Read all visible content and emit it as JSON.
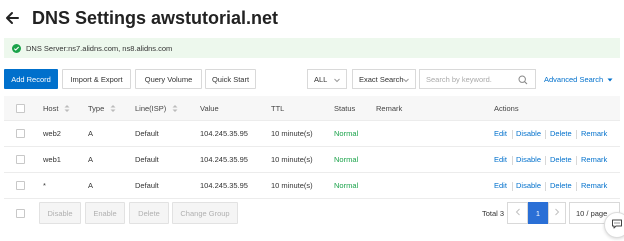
{
  "header": {
    "title": "DNS Settings awstutorial.net"
  },
  "info": {
    "text": "DNS Server:ns7.alidns.com, ns8.alidns.com"
  },
  "toolbar": {
    "add_record": "Add Record",
    "import_export": "Import & Export",
    "query_volume": "Query Volume",
    "quick_start": "Quick Start",
    "filter_select": "ALL",
    "search_type": "Exact Search",
    "search_placeholder": "Search by keyword.",
    "advanced_search": "Advanced Search"
  },
  "table": {
    "columns": {
      "host": "Host",
      "type": "Type",
      "line": "Line(ISP)",
      "value": "Value",
      "ttl": "TTL",
      "status": "Status",
      "remark": "Remark",
      "actions": "Actions"
    },
    "rows": [
      {
        "host": "web2",
        "type": "A",
        "line": "Default",
        "value": "104.245.35.95",
        "ttl": "10 minute(s)",
        "status": "Normal",
        "remark": ""
      },
      {
        "host": "web1",
        "type": "A",
        "line": "Default",
        "value": "104.245.35.95",
        "ttl": "10 minute(s)",
        "status": "Normal",
        "remark": ""
      },
      {
        "host": "*",
        "type": "A",
        "line": "Default",
        "value": "104.245.35.95",
        "ttl": "10 minute(s)",
        "status": "Normal",
        "remark": ""
      }
    ],
    "actions": {
      "edit": "Edit",
      "disable": "Disable",
      "delete": "Delete",
      "remark": "Remark"
    }
  },
  "footer": {
    "disable": "Disable",
    "enable": "Enable",
    "delete": "Delete",
    "change_group": "Change Group",
    "total": "Total 3",
    "current_page": "1",
    "page_size": "10 / page"
  },
  "colors": {
    "accent": "#0070cc",
    "success": "#1aa34a",
    "info_bg": "#edf8ed"
  },
  "icons": [
    "back-arrow-icon",
    "check-circle-icon",
    "chevron-down-icon",
    "search-icon",
    "sort-icon",
    "chevron-left-icon",
    "chevron-right-icon",
    "chat-icon"
  ]
}
